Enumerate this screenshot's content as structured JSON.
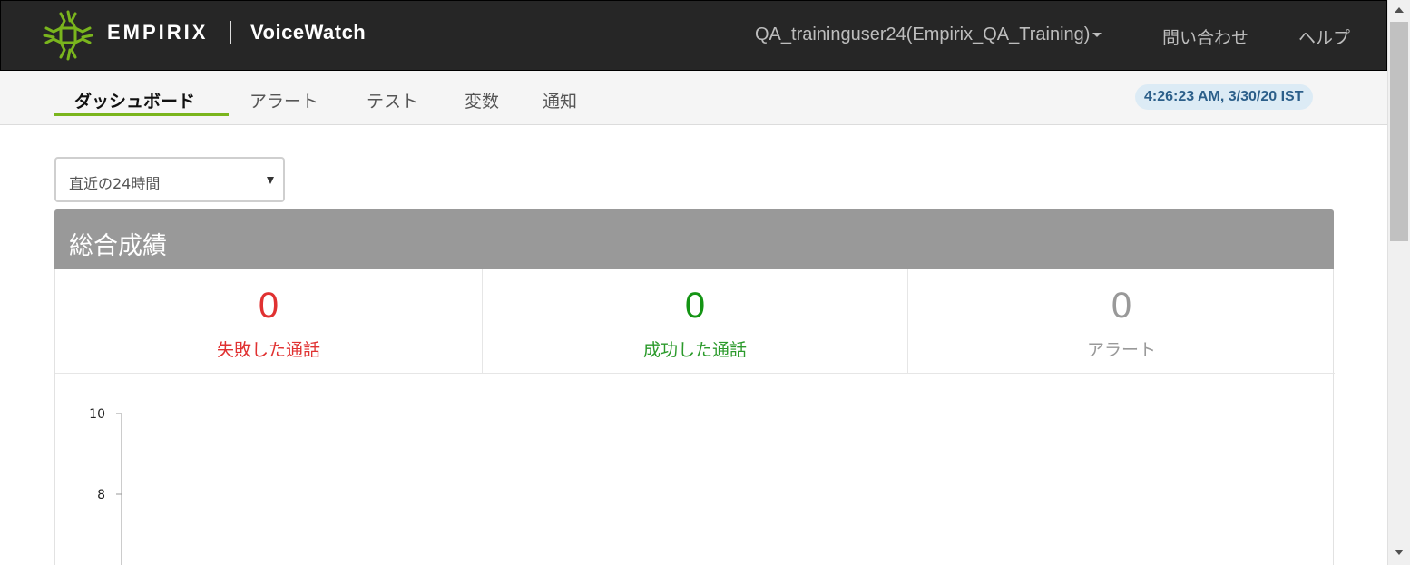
{
  "header": {
    "brand": "EMPIRIX",
    "product": "VoiceWatch",
    "user_menu": "QA_traininguser24(Empirix_QA_Training)",
    "contact_link": "問い合わせ",
    "help_link": "ヘルプ"
  },
  "nav": {
    "tabs": [
      {
        "label": "ダッシュボード",
        "active": true
      },
      {
        "label": "アラート"
      },
      {
        "label": "テスト"
      },
      {
        "label": "変数"
      },
      {
        "label": "通知"
      }
    ],
    "clock": "4:26:23 AM, 3/30/20 IST"
  },
  "filter": {
    "range_selected": "直近の24時間"
  },
  "panel": {
    "title": "総合成績",
    "stats": [
      {
        "value": "0",
        "label": "失敗した通話",
        "color": "#e03131"
      },
      {
        "value": "0",
        "label": "成功した通話",
        "color": "#2b9a2b"
      },
      {
        "value": "0",
        "label": "アラート",
        "color": "#999999"
      }
    ]
  },
  "colors": {
    "header_bg": "#262626",
    "accent": "#7ab51d",
    "clock_bg": "#dcebf5",
    "clock_text": "#2c5f8a",
    "panel_head_bg": "#999999"
  },
  "chart_data": {
    "type": "line",
    "title": "",
    "xlabel": "",
    "ylabel": "",
    "y_ticks": [
      "10",
      "8"
    ],
    "ylim": [
      0,
      10
    ],
    "series": []
  }
}
